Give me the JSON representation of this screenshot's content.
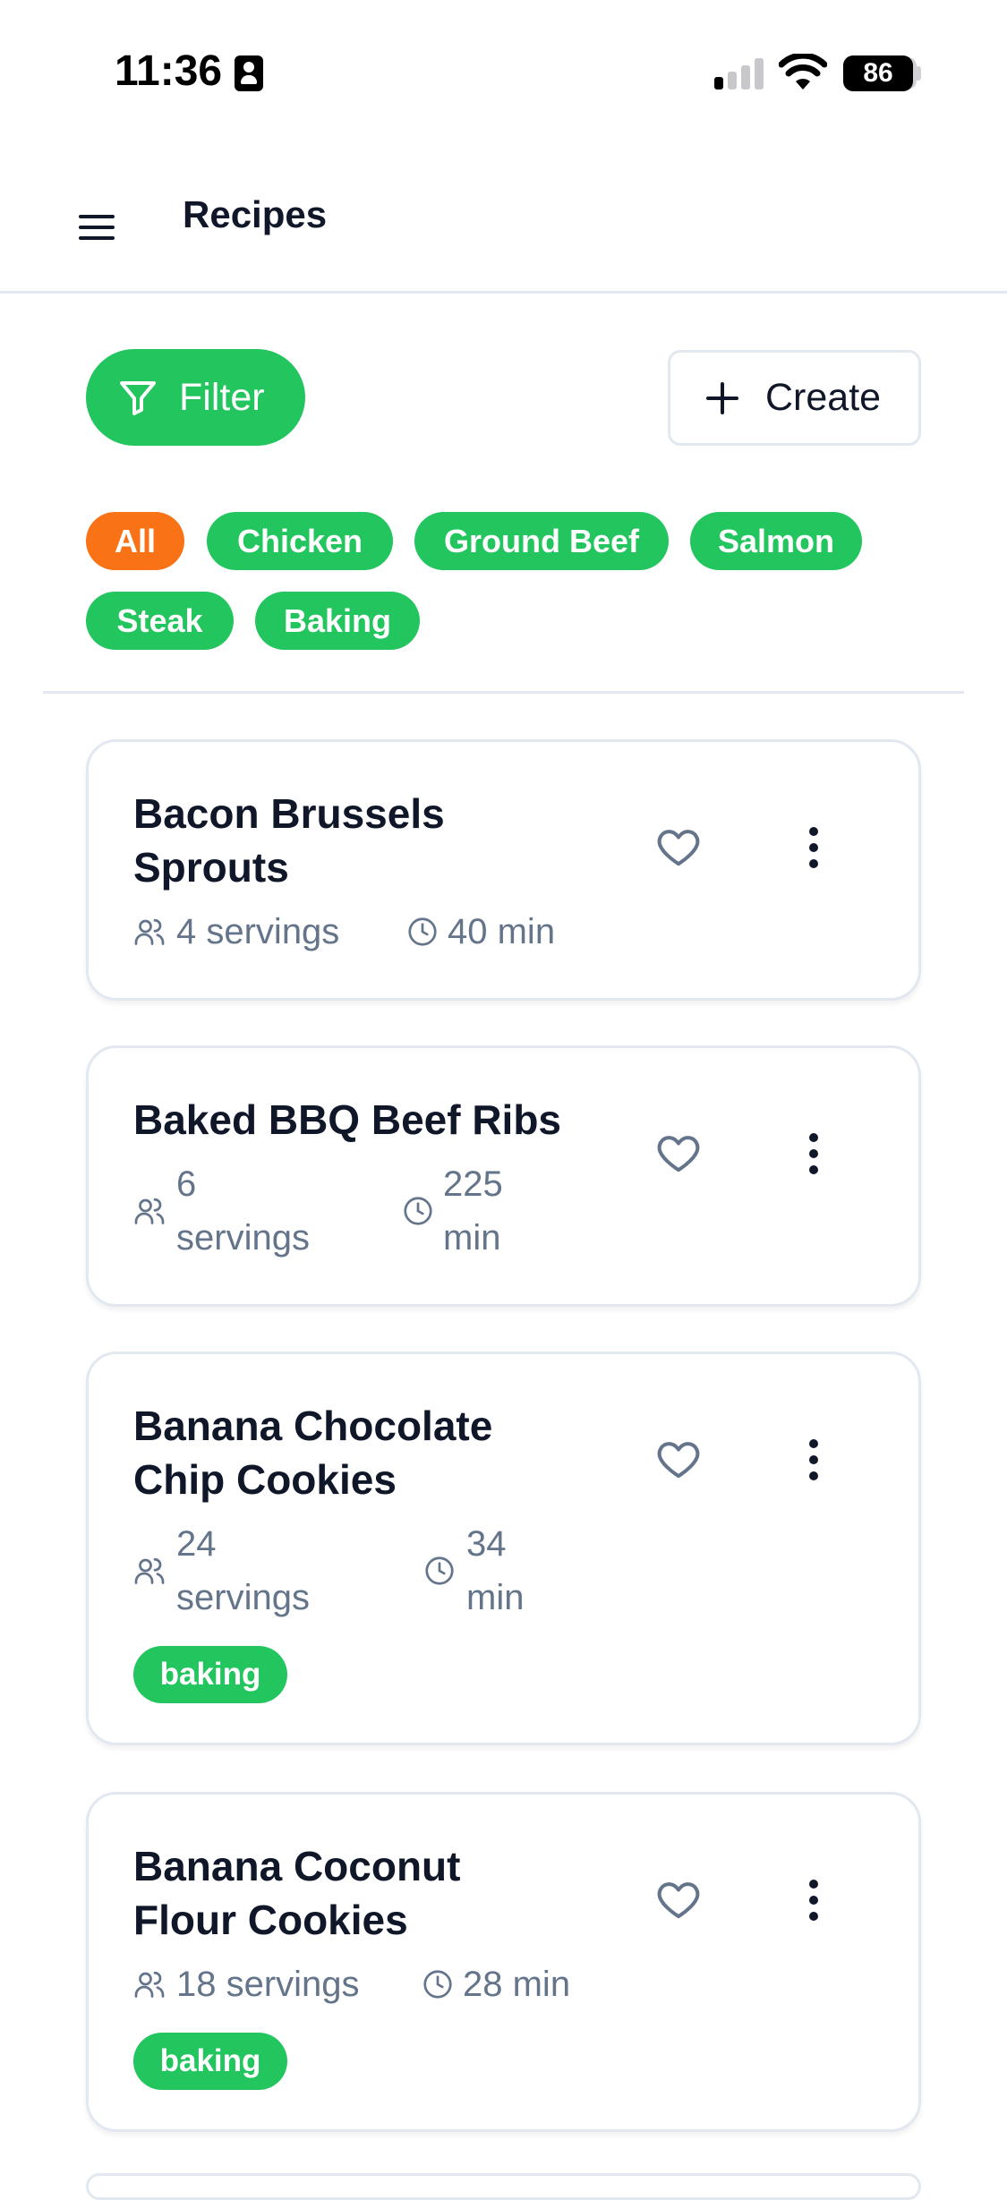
{
  "status_bar": {
    "time": "11:36",
    "battery": "86"
  },
  "header": {
    "title": "Recipes"
  },
  "toolbar": {
    "filter_label": "Filter",
    "create_label": "Create"
  },
  "categories": [
    {
      "label": "All",
      "active": true
    },
    {
      "label": "Chicken",
      "active": false
    },
    {
      "label": "Ground Beef",
      "active": false
    },
    {
      "label": "Salmon",
      "active": false
    },
    {
      "label": "Steak",
      "active": false
    },
    {
      "label": "Baking",
      "active": false
    }
  ],
  "recipes": [
    {
      "title_lines": [
        "Bacon Brussels",
        "Sprouts"
      ],
      "servings_lines": [
        "4 servings"
      ],
      "time_lines": [
        "40 min"
      ],
      "tag": ""
    },
    {
      "title_lines": [
        "Baked BBQ Beef Ribs"
      ],
      "servings_lines": [
        "6",
        "servings"
      ],
      "time_lines": [
        "225",
        "min"
      ],
      "tag": ""
    },
    {
      "title_lines": [
        "Banana Chocolate",
        "Chip Cookies"
      ],
      "servings_lines": [
        "24",
        "servings"
      ],
      "time_lines": [
        "34",
        "min"
      ],
      "tag": "baking"
    },
    {
      "title_lines": [
        "Banana Coconut",
        "Flour Cookies"
      ],
      "servings_lines": [
        "18 servings"
      ],
      "time_lines": [
        "28 min"
      ],
      "tag": "baking"
    }
  ],
  "colors": {
    "primary": "#22c55e",
    "active_chip": "#f97316",
    "muted_text": "#64748b",
    "border": "#e2e8f0"
  },
  "icons": {
    "menu": "hamburger-menu-icon",
    "filter": "filter-funnel-icon",
    "create": "plus-icon",
    "favorite": "heart-outline-icon",
    "more": "more-vertical-icon",
    "servings": "users-icon",
    "time": "clock-icon"
  }
}
